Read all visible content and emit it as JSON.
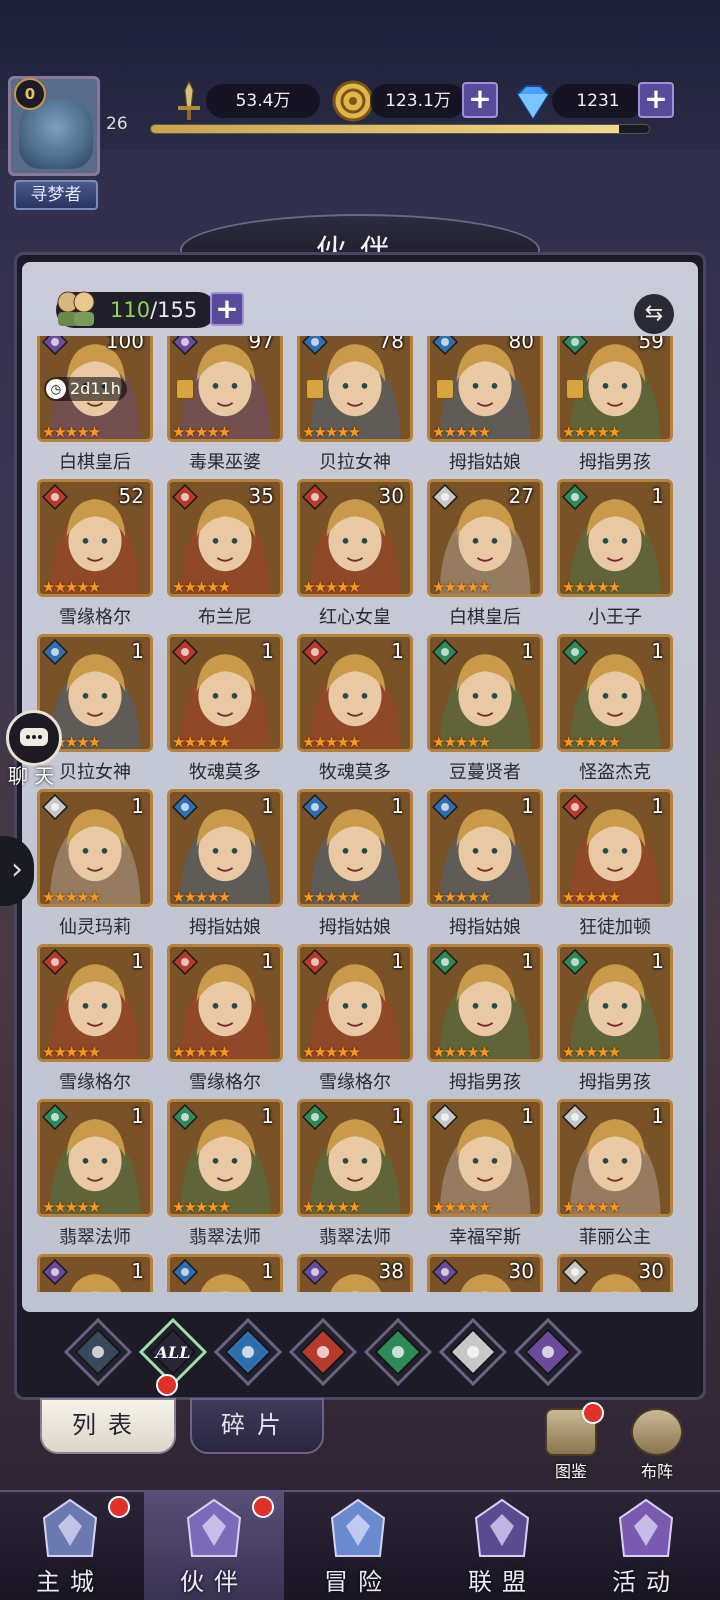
{
  "player": {
    "badge_level": "0",
    "title": "寻梦者",
    "level": "26",
    "xp_fraction": 0.94
  },
  "resources": {
    "power": "53.4万",
    "gold": "123.1万",
    "gems": "1231"
  },
  "page_title": "伙伴",
  "roster": {
    "owned": "110",
    "capacity": "/155"
  },
  "heroes": [
    {
      "name": "白棋皇后",
      "level": "100",
      "element": "dark",
      "timer": "2d11h",
      "stars": 5
    },
    {
      "name": "毒果巫婆",
      "level": "97",
      "element": "dark",
      "rank": true,
      "stars": 5
    },
    {
      "name": "贝拉女神",
      "level": "78",
      "element": "water",
      "rank": true,
      "stars": 5
    },
    {
      "name": "拇指姑娘",
      "level": "80",
      "element": "water",
      "rank": true,
      "stars": 5
    },
    {
      "name": "拇指男孩",
      "level": "59",
      "element": "wind",
      "rank": true,
      "stars": 5
    },
    {
      "name": "雪缘格尔",
      "level": "52",
      "element": "fire",
      "stars": 5
    },
    {
      "name": "布兰尼",
      "level": "35",
      "element": "fire",
      "stars": 5
    },
    {
      "name": "红心女皇",
      "level": "30",
      "element": "fire",
      "stars": 5
    },
    {
      "name": "白棋皇后",
      "level": "27",
      "element": "light",
      "stars": 5
    },
    {
      "name": "小王子",
      "level": "1",
      "element": "wind",
      "stars": 5
    },
    {
      "name": "贝拉女神",
      "level": "1",
      "element": "water",
      "stars": 5
    },
    {
      "name": "牧魂莫多",
      "level": "1",
      "element": "fire",
      "stars": 5
    },
    {
      "name": "牧魂莫多",
      "level": "1",
      "element": "fire",
      "stars": 5
    },
    {
      "name": "豆蔓贤者",
      "level": "1",
      "element": "wind",
      "stars": 5
    },
    {
      "name": "怪盗杰克",
      "level": "1",
      "element": "wind",
      "stars": 5
    },
    {
      "name": "仙灵玛莉",
      "level": "1",
      "element": "light",
      "stars": 5
    },
    {
      "name": "拇指姑娘",
      "level": "1",
      "element": "water",
      "stars": 5
    },
    {
      "name": "拇指姑娘",
      "level": "1",
      "element": "water",
      "stars": 5
    },
    {
      "name": "拇指姑娘",
      "level": "1",
      "element": "water",
      "stars": 5
    },
    {
      "name": "狂徒加顿",
      "level": "1",
      "element": "fire",
      "stars": 5
    },
    {
      "name": "雪缘格尔",
      "level": "1",
      "element": "fire",
      "stars": 5
    },
    {
      "name": "雪缘格尔",
      "level": "1",
      "element": "fire",
      "stars": 5
    },
    {
      "name": "雪缘格尔",
      "level": "1",
      "element": "fire",
      "stars": 5
    },
    {
      "name": "拇指男孩",
      "level": "1",
      "element": "wind",
      "stars": 5
    },
    {
      "name": "拇指男孩",
      "level": "1",
      "element": "wind",
      "stars": 5
    },
    {
      "name": "翡翠法师",
      "level": "1",
      "element": "wind",
      "stars": 5
    },
    {
      "name": "翡翠法师",
      "level": "1",
      "element": "wind",
      "stars": 5
    },
    {
      "name": "翡翠法师",
      "level": "1",
      "element": "wind",
      "stars": 5
    },
    {
      "name": "幸福罕斯",
      "level": "1",
      "element": "light",
      "stars": 5
    },
    {
      "name": "菲丽公主",
      "level": "1",
      "element": "light",
      "stars": 5
    },
    {
      "name": "",
      "level": "1",
      "element": "dark",
      "stars": 5
    },
    {
      "name": "",
      "level": "1",
      "element": "water",
      "stars": 5
    },
    {
      "name": "",
      "level": "38",
      "element": "dark",
      "stars": 5
    },
    {
      "name": "",
      "level": "30",
      "element": "dark",
      "stars": 5
    },
    {
      "name": "",
      "level": "30",
      "element": "light",
      "stars": 5
    }
  ],
  "filters": [
    {
      "key": "all-dark",
      "label": ""
    },
    {
      "key": "all",
      "label": "ALL"
    },
    {
      "key": "water",
      "label": ""
    },
    {
      "key": "fire",
      "label": ""
    },
    {
      "key": "wind",
      "label": ""
    },
    {
      "key": "light",
      "label": ""
    },
    {
      "key": "dark",
      "label": ""
    }
  ],
  "tabs": {
    "list": "列表",
    "fragments": "碎片"
  },
  "side_buttons": {
    "codex": "图鉴",
    "formation": "布阵"
  },
  "chat_label": "聊 天",
  "nav": [
    {
      "key": "main-city",
      "label": "主城"
    },
    {
      "key": "partners",
      "label": "伙伴"
    },
    {
      "key": "adventure",
      "label": "冒险"
    },
    {
      "key": "alliance",
      "label": "联盟"
    },
    {
      "key": "events",
      "label": "活动"
    }
  ],
  "element_colors": {
    "water": "#2f6fb0",
    "fire": "#b83a2a",
    "wind": "#2f8a5a",
    "light": "#c8c8c8",
    "dark": "#6a4a9a"
  }
}
